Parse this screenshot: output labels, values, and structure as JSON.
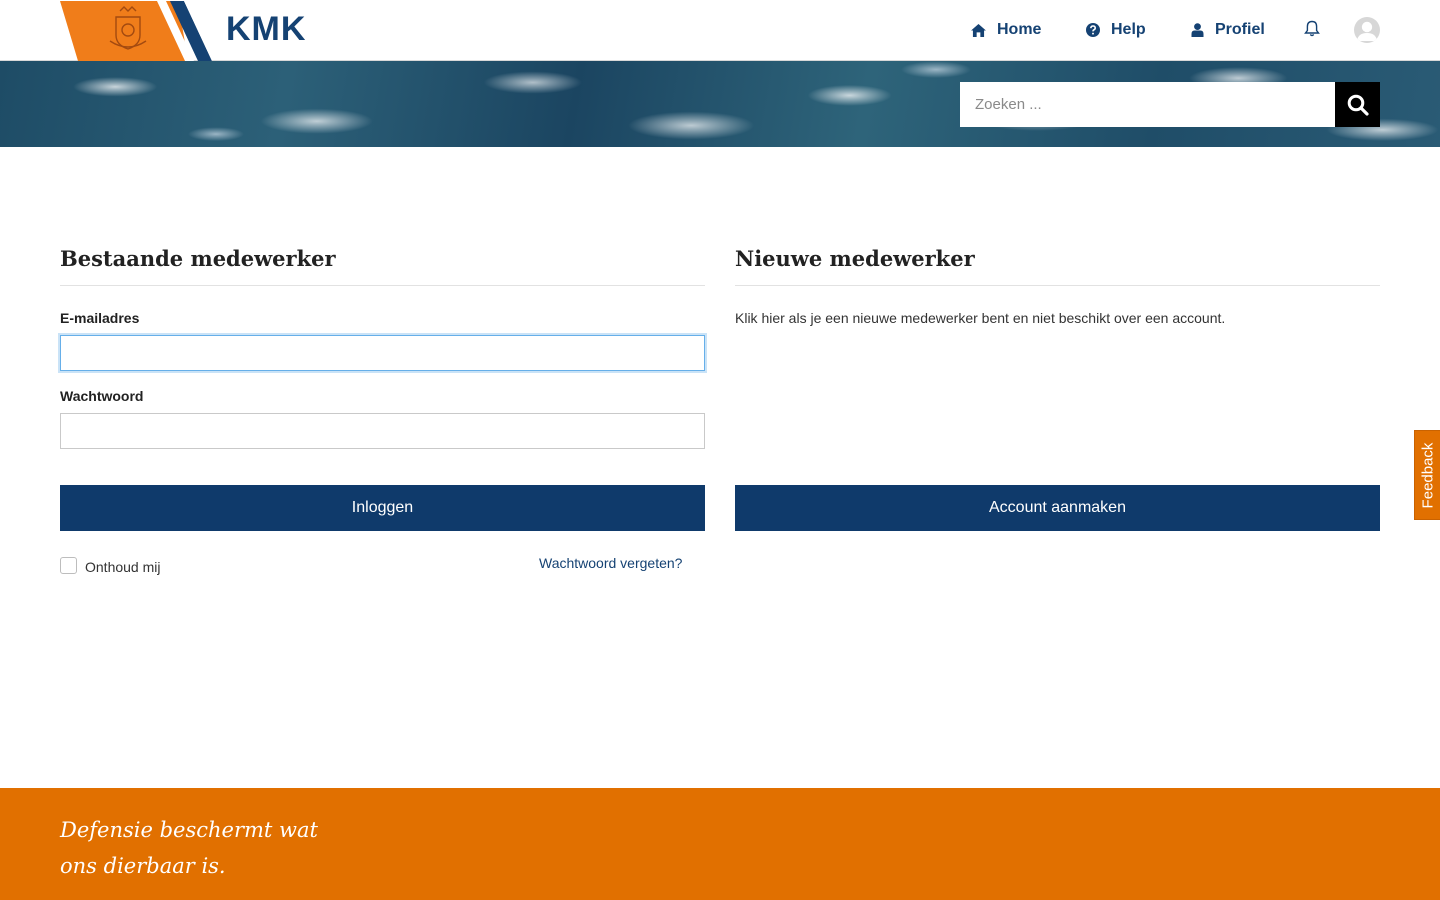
{
  "header": {
    "brand": "KMK",
    "nav": [
      {
        "label": "Home",
        "icon": "home-icon"
      },
      {
        "label": "Help",
        "icon": "question-circle-icon"
      },
      {
        "label": "Profiel",
        "icon": "user-icon"
      }
    ],
    "bell_icon": "bell-icon",
    "avatar_icon": "avatar-icon"
  },
  "search": {
    "placeholder": "Zoeken ...",
    "button_icon": "search-icon"
  },
  "login": {
    "title": "Bestaande medewerker",
    "email_label": "E-mailadres",
    "email_value": "",
    "password_label": "Wachtwoord",
    "password_value": "",
    "submit_label": "Inloggen",
    "remember_label": "Onthoud mij",
    "remember_checked": false,
    "forgot_label": "Wachtwoord vergeten?"
  },
  "register": {
    "title": "Nieuwe medewerker",
    "intro": "Klik hier als je een nieuwe medewerker bent en niet beschikt over een account.",
    "submit_label": "Account aanmaken"
  },
  "feedback": {
    "label": "Feedback"
  },
  "footer": {
    "tagline_line1": "Defensie beschermt wat",
    "tagline_line2": "ons dierbaar is."
  },
  "colors": {
    "primary": "#0f3a6b",
    "brand_text": "#154273",
    "accent_orange": "#e17000"
  }
}
